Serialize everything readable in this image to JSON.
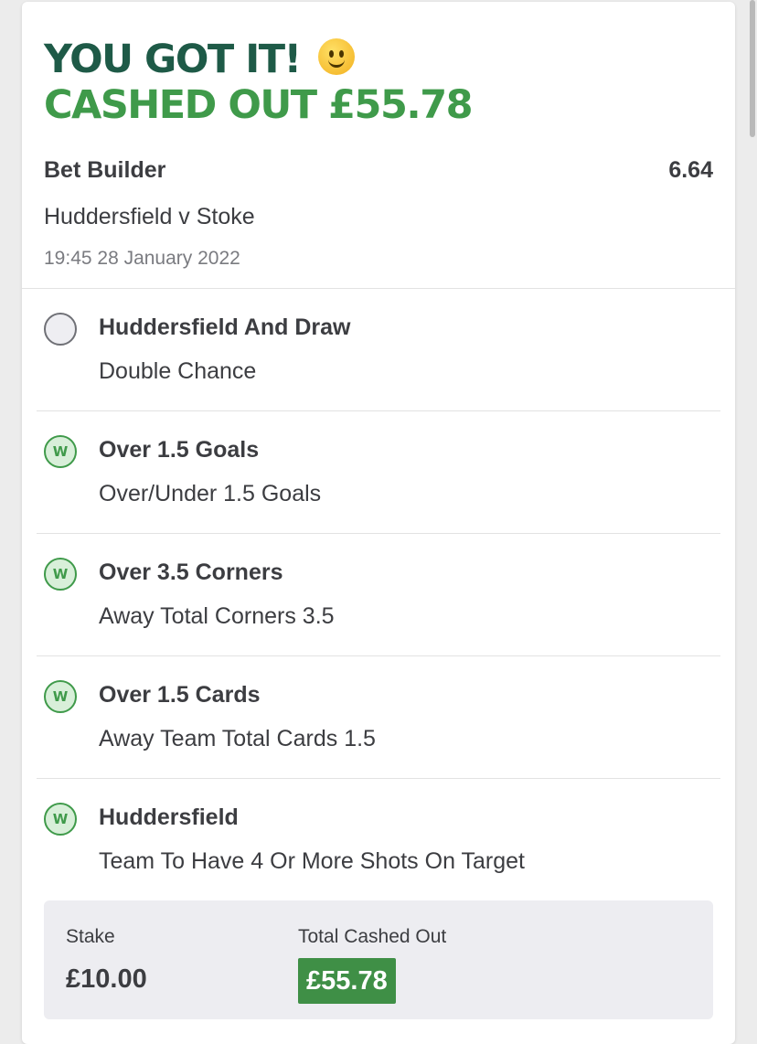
{
  "header": {
    "headline": "YOU GOT IT!",
    "headline_emoji": "slightly-smiling-face-icon",
    "subheadline": "CASHED OUT £55.78"
  },
  "bet": {
    "type": "Bet Builder",
    "odds": "6.64",
    "match": "Huddersfield v Stoke",
    "datetime": "19:45 28 January 2022"
  },
  "selections": [
    {
      "title": "Huddersfield And Draw",
      "market": "Double Chance",
      "status": "pending",
      "badge": ""
    },
    {
      "title": "Over 1.5 Goals",
      "market": "Over/Under 1.5 Goals",
      "status": "won",
      "badge": "W"
    },
    {
      "title": "Over 3.5 Corners",
      "market": "Away Total Corners 3.5",
      "status": "won",
      "badge": "W"
    },
    {
      "title": "Over 1.5 Cards",
      "market": "Away Team Total Cards 1.5",
      "status": "won",
      "badge": "W"
    },
    {
      "title": "Huddersfield",
      "market": "Team To Have 4 Or More Shots On Target",
      "status": "won",
      "badge": "W"
    }
  ],
  "summary": {
    "stake_label": "Stake",
    "stake_value": "£10.00",
    "total_label": "Total Cashed Out",
    "total_value": "£55.78"
  },
  "colors": {
    "headline": "#1e5a47",
    "accent_green": "#3f9a4a",
    "won_badge_bg": "#d8efd9",
    "cashout_badge_bg": "#3f8f46"
  }
}
